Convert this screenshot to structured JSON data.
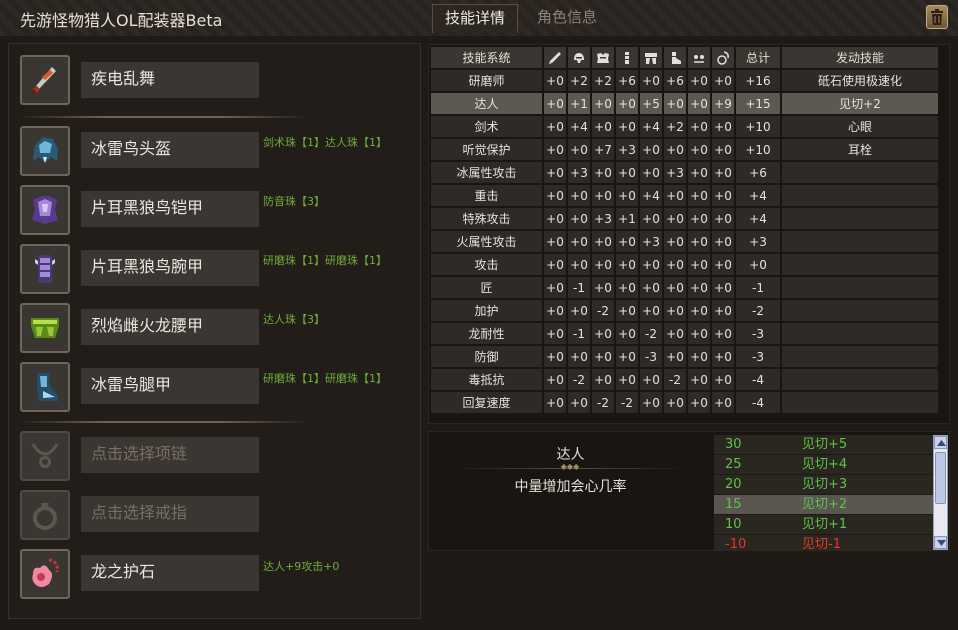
{
  "app": {
    "title": "先游怪物猎人OL配装器Beta"
  },
  "tabs": [
    {
      "label": "技能详情",
      "active": true
    },
    {
      "label": "角色信息",
      "active": false
    }
  ],
  "equipment": [
    {
      "slot": "weapon",
      "icon": "dual-blades-icon",
      "name": "疾电乱舞",
      "decorations": "",
      "empty": false
    },
    {
      "slot": "head",
      "icon": "helmet-icon",
      "name": "冰雷鸟头盔",
      "decorations": "剑术珠【1】达人珠【1】",
      "empty": false
    },
    {
      "slot": "chest",
      "icon": "chest-armor-icon",
      "name": "片耳黑狼鸟铠甲",
      "decorations": "防音珠【3】",
      "empty": false
    },
    {
      "slot": "arms",
      "icon": "arm-armor-icon",
      "name": "片耳黑狼鸟腕甲",
      "decorations": "研磨珠【1】研磨珠【1】",
      "empty": false
    },
    {
      "slot": "waist",
      "icon": "waist-armor-icon",
      "name": "烈焰雌火龙腰甲",
      "decorations": "达人珠【3】",
      "empty": false
    },
    {
      "slot": "legs",
      "icon": "leg-armor-icon",
      "name": "冰雷鸟腿甲",
      "decorations": "研磨珠【1】研磨珠【1】",
      "empty": false
    },
    {
      "slot": "necklace",
      "icon": "necklace-icon",
      "name": "点击选择项链",
      "decorations": "",
      "empty": true
    },
    {
      "slot": "ring",
      "icon": "ring-icon",
      "name": "点击选择戒指",
      "decorations": "",
      "empty": true
    },
    {
      "slot": "charm",
      "icon": "charm-icon",
      "name": "龙之护石",
      "decorations": "达人+9攻击+0",
      "empty": false
    }
  ],
  "skills_table": {
    "headers": {
      "skill_system": "技能系统",
      "total": "总计",
      "active": "发动技能"
    },
    "part_icons": [
      "weapon-icon",
      "head-icon",
      "chest-icon",
      "arms-icon",
      "waist-icon",
      "legs-icon",
      "decoration-icon",
      "charm-icon"
    ],
    "rows": [
      {
        "name": "研磨师",
        "parts": [
          "+0",
          "+2",
          "+2",
          "+6",
          "+0",
          "+6",
          "+0",
          "+0"
        ],
        "total": "+16",
        "active": "砥石使用极速化"
      },
      {
        "name": "达人",
        "parts": [
          "+0",
          "+1",
          "+0",
          "+0",
          "+5",
          "+0",
          "+0",
          "+9"
        ],
        "total": "+15",
        "active": "见切+2",
        "selected": true
      },
      {
        "name": "剑术",
        "parts": [
          "+0",
          "+4",
          "+0",
          "+0",
          "+4",
          "+2",
          "+0",
          "+0"
        ],
        "total": "+10",
        "active": "心眼"
      },
      {
        "name": "听觉保护",
        "parts": [
          "+0",
          "+0",
          "+7",
          "+3",
          "+0",
          "+0",
          "+0",
          "+0"
        ],
        "total": "+10",
        "active": "耳栓"
      },
      {
        "name": "冰属性攻击",
        "parts": [
          "+0",
          "+3",
          "+0",
          "+0",
          "+0",
          "+3",
          "+0",
          "+0"
        ],
        "total": "+6",
        "active": ""
      },
      {
        "name": "重击",
        "parts": [
          "+0",
          "+0",
          "+0",
          "+0",
          "+4",
          "+0",
          "+0",
          "+0"
        ],
        "total": "+4",
        "active": ""
      },
      {
        "name": "特殊攻击",
        "parts": [
          "+0",
          "+0",
          "+3",
          "+1",
          "+0",
          "+0",
          "+0",
          "+0"
        ],
        "total": "+4",
        "active": ""
      },
      {
        "name": "火属性攻击",
        "parts": [
          "+0",
          "+0",
          "+0",
          "+0",
          "+3",
          "+0",
          "+0",
          "+0"
        ],
        "total": "+3",
        "active": ""
      },
      {
        "name": "攻击",
        "parts": [
          "+0",
          "+0",
          "+0",
          "+0",
          "+0",
          "+0",
          "+0",
          "+0"
        ],
        "total": "+0",
        "active": ""
      },
      {
        "name": "匠",
        "parts": [
          "+0",
          "-1",
          "+0",
          "+0",
          "+0",
          "+0",
          "+0",
          "+0"
        ],
        "total": "-1",
        "active": ""
      },
      {
        "name": "加护",
        "parts": [
          "+0",
          "+0",
          "-2",
          "+0",
          "+0",
          "+0",
          "+0",
          "+0"
        ],
        "total": "-2",
        "active": ""
      },
      {
        "name": "龙耐性",
        "parts": [
          "+0",
          "-1",
          "+0",
          "+0",
          "-2",
          "+0",
          "+0",
          "+0"
        ],
        "total": "-3",
        "active": ""
      },
      {
        "name": "防御",
        "parts": [
          "+0",
          "+0",
          "+0",
          "+0",
          "-3",
          "+0",
          "+0",
          "+0"
        ],
        "total": "-3",
        "active": ""
      },
      {
        "name": "毒抵抗",
        "parts": [
          "+0",
          "-2",
          "+0",
          "+0",
          "+0",
          "-2",
          "+0",
          "+0"
        ],
        "total": "-4",
        "active": ""
      },
      {
        "name": "回复速度",
        "parts": [
          "+0",
          "+0",
          "-2",
          "-2",
          "+0",
          "+0",
          "+0",
          "+0"
        ],
        "total": "-4",
        "active": ""
      }
    ]
  },
  "skill_detail": {
    "name": "达人",
    "dots": "◆◆◆",
    "description": "中量增加会心几率",
    "thresholds": [
      {
        "points": "30",
        "skill": "见切+5",
        "negative": false
      },
      {
        "points": "25",
        "skill": "见切+4",
        "negative": false
      },
      {
        "points": "20",
        "skill": "见切+3",
        "negative": false
      },
      {
        "points": "15",
        "skill": "见切+2",
        "negative": false,
        "selected": true
      },
      {
        "points": "10",
        "skill": "见切+1",
        "negative": false
      },
      {
        "points": "-10",
        "skill": "见切-1",
        "negative": true
      }
    ]
  },
  "colors": {
    "accent_green": "#5fc24a",
    "negative_red": "#e03a2a",
    "decoration_green": "#6fae3a",
    "background": "#1f1a16"
  }
}
